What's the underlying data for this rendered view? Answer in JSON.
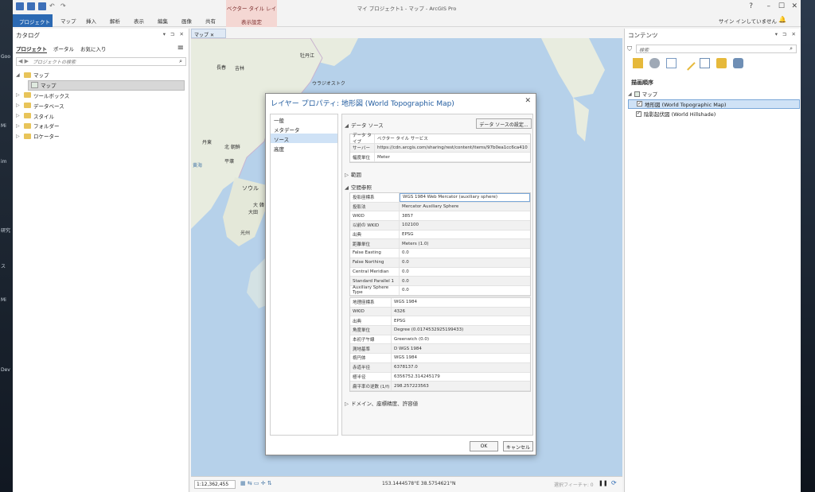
{
  "desktop": {
    "labels": [
      "Goo",
      "Mi",
      "im",
      "研究",
      "ス",
      "Mi",
      "Dev"
    ]
  },
  "window": {
    "title": "マイ プロジェクト1 - マップ - ArcGIS Pro",
    "contextual_tab_header": "ベクター タイル レイヤー"
  },
  "ribbon": {
    "tabs": [
      "プロジェクト",
      "マップ",
      "挿入",
      "解析",
      "表示",
      "編集",
      "画像",
      "共有"
    ],
    "contextual_tab": "表示設定",
    "sign_in": "サイン インしていません",
    "help": "?"
  },
  "catalog": {
    "title": "カタログ",
    "tabs": [
      "プロジェクト",
      "ポータル",
      "お気に入り"
    ],
    "search_placeholder": "プロジェクトの検索",
    "tree": [
      {
        "label": "マップ",
        "expanded": true
      },
      {
        "label": "マップ",
        "child": true,
        "selected": true
      },
      {
        "label": "ツールボックス"
      },
      {
        "label": "データベース"
      },
      {
        "label": "スタイル"
      },
      {
        "label": "フォルダー"
      },
      {
        "label": "ロケーター"
      }
    ]
  },
  "map": {
    "tab_label": "マップ",
    "labels": [
      "牡丹江",
      "長春",
      "吉林",
      "ウラジオストク",
      "丹東",
      "北 朝鮮",
      "平壌",
      "ソウル",
      "大 韓",
      "大田",
      "光州",
      "黄海"
    ],
    "scale": "1:12,362,455",
    "coordinates": "153.1444578°E 38.5754621°N",
    "selected_features": "選択フィーチャ: 0"
  },
  "contents": {
    "title": "コンテンツ",
    "search_placeholder": "検索",
    "section": "描画順序",
    "map_node": "マップ",
    "layers": [
      {
        "label": "地形図 (World Topographic Map)",
        "checked": true,
        "selected": true
      },
      {
        "label": "陰影起伏図 (World Hillshade)",
        "checked": true,
        "selected": false
      }
    ]
  },
  "dialog": {
    "title": "レイヤー プロパティ: 地形図 (World Topographic Map)",
    "nav": [
      "一般",
      "メタデータ",
      "ソース",
      "高度"
    ],
    "nav_selected": 2,
    "data_source": {
      "heading": "データ ソース",
      "settings_button": "データ ソースの設定...",
      "rows": [
        {
          "k": "データ タイプ",
          "v": "ベクター タイル サービス"
        },
        {
          "k": "サーバー",
          "v": "https://cdn.arcgis.com/sharing/rest/content/items/97b0ea1cc6ca410"
        },
        {
          "k": "幅度単位",
          "v": "Meter"
        }
      ]
    },
    "extent_heading": "範囲",
    "spatial_reference": {
      "heading": "空間参照",
      "projected": [
        {
          "k": "投影座標系",
          "v": "WGS 1984 Web Mercator (auxiliary sphere)"
        },
        {
          "k": "投影法",
          "v": "Mercator Auxiliary Sphere"
        },
        {
          "k": "WKID",
          "v": "3857"
        },
        {
          "k": "以前の WKID",
          "v": "102100"
        },
        {
          "k": "出典",
          "v": "EPSG"
        },
        {
          "k": "距離単位",
          "v": "Meters (1.0)"
        },
        {
          "k": "False Easting",
          "v": "0.0"
        },
        {
          "k": "False Northing",
          "v": "0.0"
        },
        {
          "k": "Central Meridian",
          "v": "0.0"
        },
        {
          "k": "Standard Parallel 1",
          "v": "0.0"
        },
        {
          "k": "Auxiliary Sphere Type",
          "v": "0.0"
        }
      ],
      "geographic": [
        {
          "k": "地理座標系",
          "v": "WGS 1984"
        },
        {
          "k": "WKID",
          "v": "4326"
        },
        {
          "k": "出典",
          "v": "EPSG"
        },
        {
          "k": "角度単位",
          "v": "Degree (0.0174532925199433)"
        },
        {
          "k": "本初子午線",
          "v": "Greenwich (0.0)"
        },
        {
          "k": "測地基準",
          "v": "D WGS 1984"
        },
        {
          "k": "楕円体",
          "v": "WGS 1984"
        },
        {
          "k": "赤道半径",
          "v": "6378137.0"
        },
        {
          "k": "極半径",
          "v": "6356752.314245179"
        },
        {
          "k": "扁平率の逆数 (1/f)",
          "v": "298.257223563"
        }
      ]
    },
    "domain_heading": "ドメイン、座標精度、許容値",
    "ok": "OK",
    "cancel": "キャンセル"
  },
  "colors": {
    "accent": "#2b69b3",
    "contextual": "#f4d7d3",
    "water": "#b6d1ea",
    "land": "#e8ecdf"
  }
}
